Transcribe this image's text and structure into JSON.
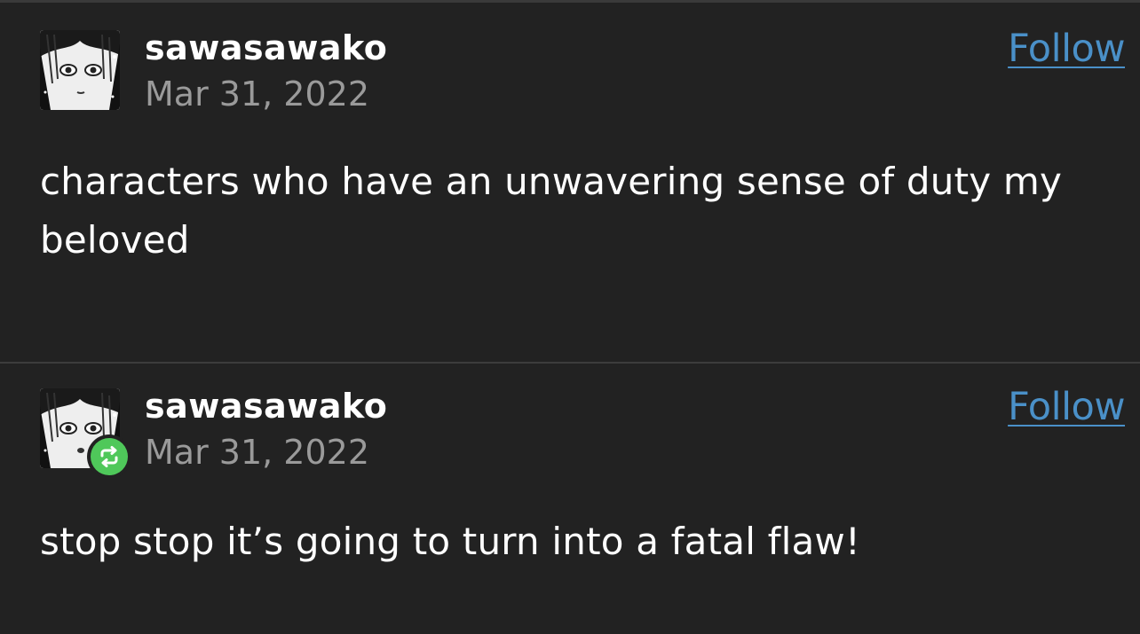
{
  "posts": [
    {
      "username": "sawasawako",
      "date": "Mar 31, 2022",
      "follow_label": "Follow",
      "body": "characters who have an unwavering sense of duty my beloved",
      "reblog": false
    },
    {
      "username": "sawasawako",
      "date": "Mar 31, 2022",
      "follow_label": "Follow",
      "body": "stop stop it’s going to turn into a fatal flaw!",
      "reblog": true,
      "reblog_icon": "reblog-icon"
    }
  ],
  "colors": {
    "background": "#222222",
    "link": "#4a90c8",
    "muted": "#9a9a9a",
    "reblog_badge": "#4fc85a"
  }
}
